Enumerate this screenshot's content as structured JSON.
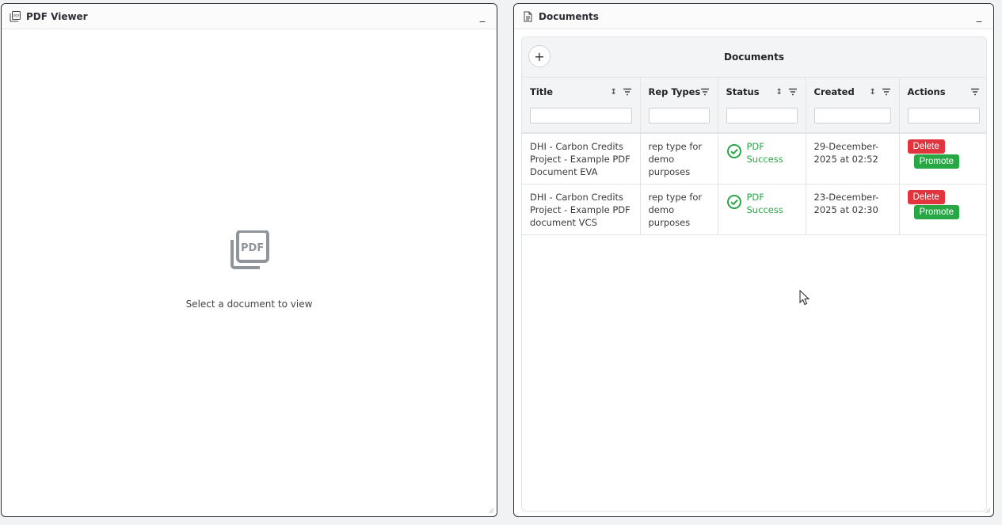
{
  "left_panel": {
    "title": "PDF Viewer",
    "minimize": "_",
    "empty_text": "Select a document to view",
    "icon": "pdf-icon"
  },
  "right_panel": {
    "title": "Documents",
    "minimize": "_",
    "icon": "document-icon",
    "card": {
      "title": "Documents",
      "add_label": "+",
      "columns": [
        {
          "label": "Title",
          "sortable": true
        },
        {
          "label": "Rep Types",
          "sortable": false
        },
        {
          "label": "Status",
          "sortable": true
        },
        {
          "label": "Created",
          "sortable": true
        },
        {
          "label": "Actions",
          "sortable": false
        }
      ],
      "rows": [
        {
          "title": "DHI - Carbon Credits Project - Example PDF Document EVA",
          "rep_type": "rep type for demo purposes",
          "status": "PDF Success",
          "created": "29-December-2025 at 02:52",
          "delete_label": "Delete",
          "promote_label": "Promote"
        },
        {
          "title": "DHI - Carbon Credits Project - Example PDF document VCS",
          "rep_type": "rep type for demo purposes",
          "status": "PDF Success",
          "created": "23-December-2025 at 02:30",
          "delete_label": "Delete",
          "promote_label": "Promote"
        }
      ]
    }
  },
  "colors": {
    "success": "#28a745",
    "danger": "#e0353f",
    "border": "#2b2f33"
  }
}
